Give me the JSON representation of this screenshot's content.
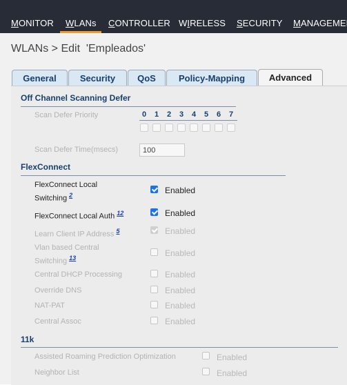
{
  "nav": {
    "items": [
      {
        "key": "M",
        "rest": "ONITOR",
        "label": "MONITOR"
      },
      {
        "key": "W",
        "rest": "LANs",
        "label": "WLANs"
      },
      {
        "key": "C",
        "rest": "ONTROLLER",
        "label": "CONTROLLER"
      },
      {
        "key": "W",
        "rest": "IRELESS",
        "prefix": "",
        "label": "WIRELESS"
      },
      {
        "key": "S",
        "rest": "ECURITY",
        "label": "SECURITY"
      },
      {
        "key": "M",
        "rest": "ANAGEMEN",
        "label": "MANAGEMENT"
      }
    ],
    "active_color": "#f29a2e"
  },
  "page_title": "WLANs > Edit  'Empleados'",
  "tabs": [
    "General",
    "Security",
    "QoS",
    "Policy-Mapping",
    "Advanced"
  ],
  "off_channel": {
    "heading": "Off Channel Scanning Defer",
    "priority_label": "Scan Defer Priority",
    "priority_digits": [
      "0",
      "1",
      "2",
      "3",
      "4",
      "5",
      "6",
      "7"
    ],
    "time_label": "Scan Defer Time(msecs)",
    "time_value": "100"
  },
  "flexconnect": {
    "heading": "FlexConnect",
    "rows": [
      {
        "label_1": "FlexConnect Local",
        "label_2": "Switching",
        "note": "2",
        "checked": true,
        "enabled": true,
        "state": "Enabled"
      },
      {
        "label_1": "FlexConnect Local Auth",
        "note": "12",
        "checked": true,
        "enabled": true,
        "state": "Enabled"
      },
      {
        "label_1": "Learn Client IP Address",
        "note": "5",
        "checked": true,
        "enabled": false,
        "state": "Enabled"
      },
      {
        "label_1": "Vlan based Central",
        "label_2": "Switching",
        "note": "13",
        "checked": false,
        "enabled": false,
        "state": "Enabled"
      },
      {
        "label_1": "Central DHCP Processing",
        "checked": false,
        "enabled": false,
        "state": "Enabled"
      },
      {
        "label_1": "Override DNS",
        "checked": false,
        "enabled": false,
        "state": "Enabled"
      },
      {
        "label_1": "NAT-PAT",
        "checked": false,
        "enabled": false,
        "state": "Enabled"
      },
      {
        "label_1": "Central Assoc",
        "checked": false,
        "enabled": false,
        "state": "Enabled"
      }
    ]
  },
  "eleven_k": {
    "heading": "11k",
    "rows": [
      {
        "label": "Assisted Roaming Prediction Optimization",
        "state": "Enabled"
      },
      {
        "label": "Neighbor List",
        "state": "Enabled"
      }
    ]
  }
}
